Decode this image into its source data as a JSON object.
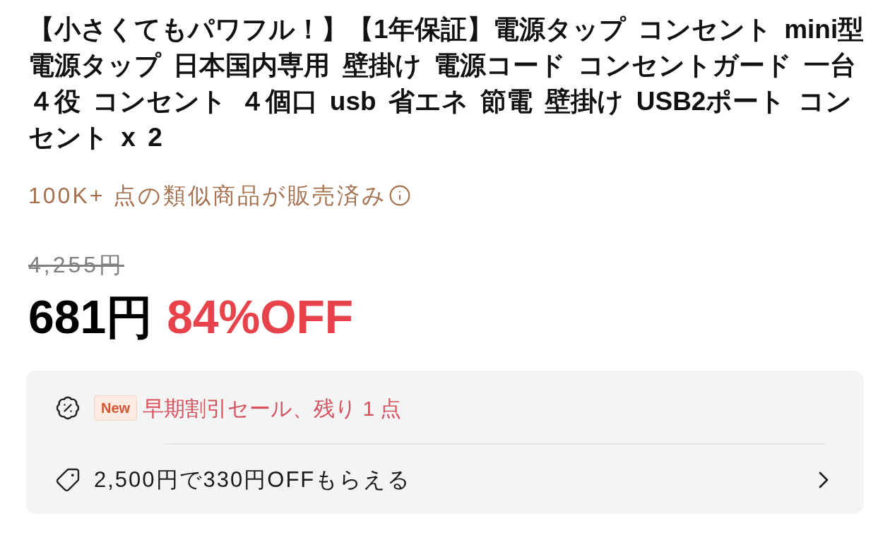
{
  "title": "【小さくてもパワフル！】【1年保証】電源タップ コンセント mini型電源タップ 日本国内専用 壁掛け 電源コード コンセントガード 一台４役 コンセント ４個口 usb 省エネ 節電 壁掛け USB2ポート コンセント x 2",
  "sold_count": "100K+ 点の類似商品が販売済み",
  "original_price": "4,255円",
  "price": "681円",
  "discount": "84%OFF",
  "promotions": [
    {
      "kind": "sale",
      "badge": "New",
      "text": "早期割引セール、残り 1 点"
    },
    {
      "kind": "coupon",
      "text": "2,500円で330円OFFもらえる"
    }
  ]
}
